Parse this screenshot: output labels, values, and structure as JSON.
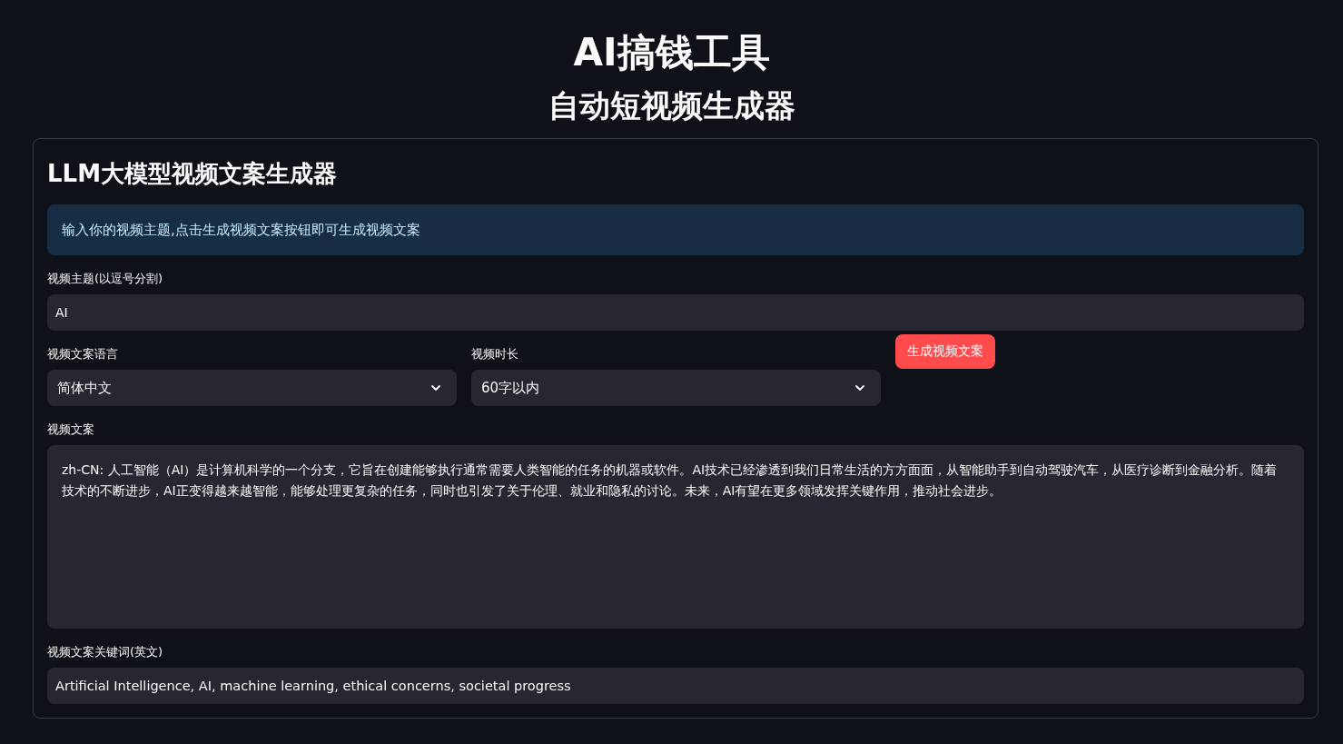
{
  "header": {
    "title": "AI搞钱工具",
    "subtitle": "自动短视频生成器"
  },
  "card": {
    "heading": "LLM大模型视频文案生成器",
    "info": "输入你的视频主题,点击生成视频文案按钮即可生成视频文案",
    "topic_field": {
      "label": "视频主题(以逗号分割)",
      "value": "AI"
    },
    "language_select": {
      "label": "视频文案语言",
      "value": "简体中文"
    },
    "duration_select": {
      "label": "视频时长",
      "value": "60字以内"
    },
    "generate_button": "生成视频文案",
    "script_field": {
      "label": "视频文案",
      "value": "zh-CN: 人工智能（AI）是计算机科学的一个分支，它旨在创建能够执行通常需要人类智能的任务的机器或软件。AI技术已经渗透到我们日常生活的方方面面，从智能助手到自动驾驶汽车，从医疗诊断到金融分析。随着技术的不断进步，AI正变得越来越智能，能够处理更复杂的任务，同时也引发了关于伦理、就业和隐私的讨论。未来，AI有望在更多领域发挥关键作用，推动社会进步。"
    },
    "keywords_field": {
      "label": "视频文案关键词(英文)",
      "value": "Artificial Intelligence, AI, machine learning, ethical concerns, societal progress"
    }
  }
}
